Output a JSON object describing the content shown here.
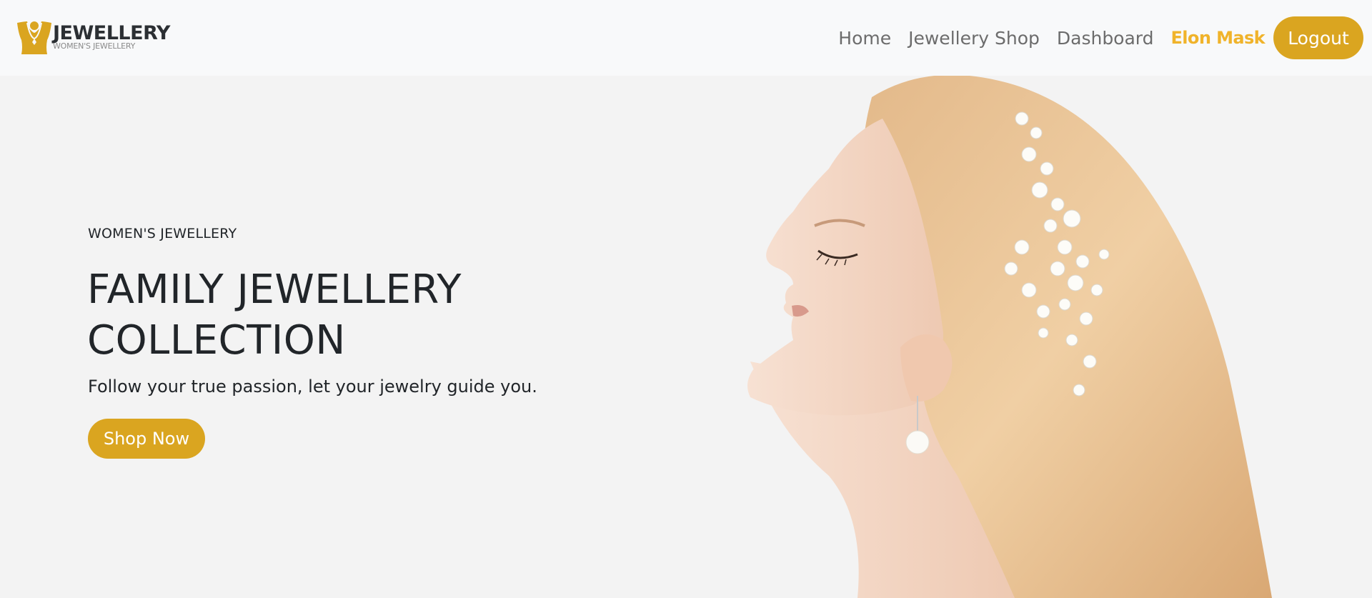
{
  "brand": {
    "title": "JEWELLERY",
    "subtitle": "WOMEN'S JEWELLERY",
    "logo_icon": "necklace-bust-icon"
  },
  "nav": {
    "links": [
      "Home",
      "Jewellery Shop",
      "Dashboard"
    ],
    "user_name": "Elon Mask",
    "logout_label": "Logout"
  },
  "hero": {
    "eyebrow": "WOMEN'S JEWELLERY",
    "headline": "FAMILY JEWELLERY COLLECTION",
    "tagline": "Follow your true passion, let your jewelry guide you.",
    "cta_label": "Shop Now",
    "image_subject": "woman-profile-pearl-hairpiece"
  },
  "colors": {
    "accent": "#daa520",
    "user_highlight": "#f0b32a",
    "navbar_bg": "#f8f9fa",
    "hero_bg": "#f3f3f3",
    "text_dark": "#212529",
    "nav_text": "#6c6c6c"
  }
}
